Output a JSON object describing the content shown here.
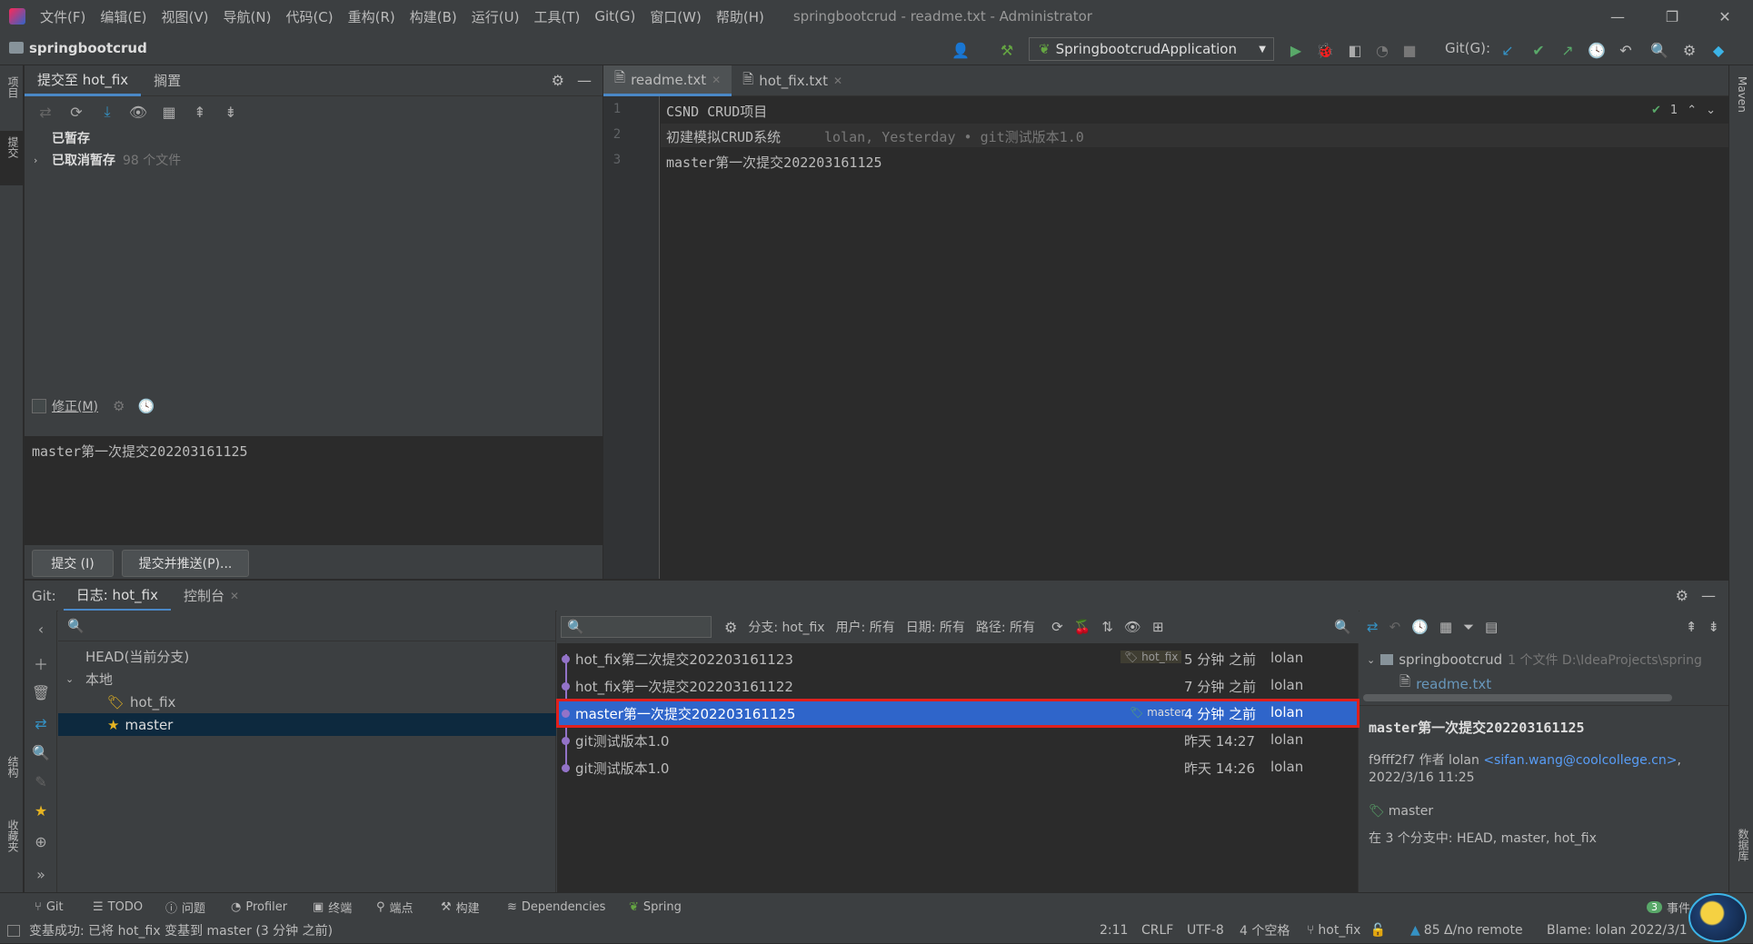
{
  "menubar": {
    "items": [
      "文件(F)",
      "编辑(E)",
      "视图(V)",
      "导航(N)",
      "代码(C)",
      "重构(R)",
      "构建(B)",
      "运行(U)",
      "工具(T)",
      "Git(G)",
      "窗口(W)",
      "帮助(H)"
    ],
    "title": "springbootcrud - readme.txt - Administrator"
  },
  "navbar": {
    "project": "springbootcrud",
    "run_config": "SpringbootcrudApplication",
    "git_label": "Git(G):"
  },
  "left_stripe": {
    "project": "项目",
    "commit": "提交",
    "structure": "结构",
    "favorites": "收藏夹"
  },
  "right_stripe": {
    "maven": "Maven",
    "database": "数据库"
  },
  "commit_panel": {
    "tab_commit": "提交至 hot_fix",
    "tab_shelf": "搁置",
    "stashed": "已暂存",
    "unstashed": "已取消暂存",
    "unstashed_count": "98 个文件",
    "amend_label": "修正(M)",
    "message": "master第一次提交202203161125",
    "commit_button": "提交 (I)",
    "commit_push_button": "提交并推送(P)..."
  },
  "editor": {
    "tabs": [
      {
        "label": "readme.txt"
      },
      {
        "label": "hot_fix.txt"
      }
    ],
    "lines": [
      "CSND CRUD项目",
      "初建模拟CRUD系统",
      "master第一次提交202203161125"
    ],
    "line_numbers": [
      "1",
      "2",
      "3"
    ],
    "blame_inline": "lolan, Yesterday • git测试版本1.0",
    "inspection_count": "1"
  },
  "bottom": {
    "git_label": "Git:",
    "tab_log": "日志: hot_fix",
    "tab_console": "控制台"
  },
  "branches": {
    "head": "HEAD(当前分支)",
    "local": "本地",
    "items": [
      {
        "name": "hot_fix"
      },
      {
        "name": "master"
      }
    ]
  },
  "log": {
    "filters": {
      "branch": "分支: hot_fix",
      "user": "用户: 所有",
      "date": "日期: 所有",
      "path": "路径: 所有"
    },
    "rows": [
      {
        "message": "hot_fix第二次提交202203161123",
        "tag": "hot_fix",
        "time": "5 分钟 之前",
        "author": "lolan"
      },
      {
        "message": "hot_fix第一次提交202203161122",
        "tag": "",
        "time": "7 分钟 之前",
        "author": "lolan"
      },
      {
        "message": "master第一次提交202203161125",
        "tag": "master",
        "time": "4 分钟 之前",
        "author": "lolan"
      },
      {
        "message": "git测试版本1.0",
        "tag": "",
        "time": "昨天 14:27",
        "author": "lolan"
      },
      {
        "message": "git测试版本1.0",
        "tag": "",
        "time": "昨天 14:26",
        "author": "lolan"
      }
    ]
  },
  "details": {
    "repo": "springbootcrud",
    "repo_meta": "1 个文件  D:\\IdeaProjects\\spring",
    "file": "readme.txt",
    "commit_msg": "master第一次提交202203161125",
    "hash_author": "f9fff2f7 作者 lolan",
    "email": "<sifan.wang@coolcollege.cn>",
    "comma": ",",
    "date": "2022/3/16 11:25",
    "branch": "master",
    "branches_line": "在 3 个分支中: HEAD, master, hot_fix"
  },
  "status_tabs": [
    "Git",
    "TODO",
    "问题",
    "Profiler",
    "终端",
    "端点",
    "构建",
    "Dependencies",
    "Spring"
  ],
  "status": {
    "message": "变基成功: 已将 hot_fix 变基到 master (3 分钟 之前)",
    "position": "2:11",
    "line_sep": "CRLF",
    "encoding": "UTF-8",
    "indent": "4 个空格",
    "branch": "hot_fix",
    "remote": "85 Δ/no remote",
    "blame": "Blame: lolan 2022/3/1",
    "events_count": "3",
    "events": "事件"
  },
  "colors": {
    "accent": "#4a88c7",
    "selection": "#2f65ca",
    "highlight_border": "#e0201c",
    "graph": "#9373c8",
    "tag": "#e6b422"
  }
}
